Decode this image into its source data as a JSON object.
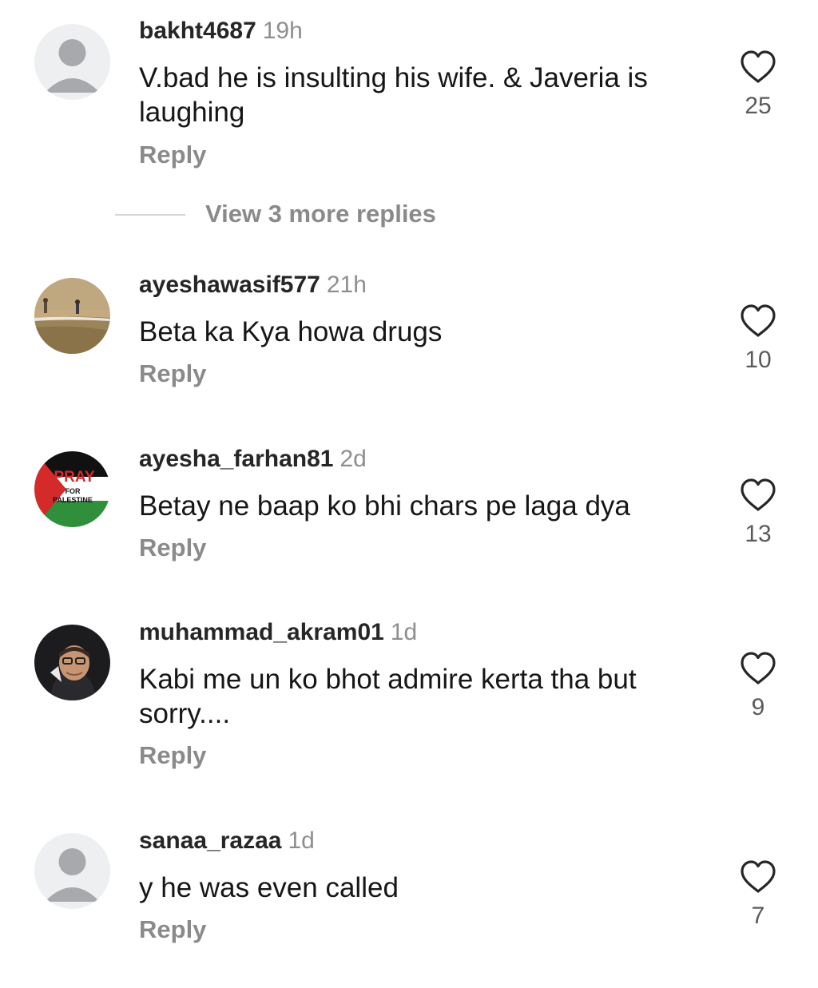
{
  "comments": [
    {
      "username": "bakht4687",
      "time": "19h",
      "text": "V.bad he is insulting his wife. & Javeria is laughing",
      "reply": "Reply",
      "likes": "25",
      "avatar": "default-avatar"
    },
    {
      "username": "ayeshawasif577",
      "time": "21h",
      "text": "Beta ka Kya howa drugs",
      "reply": "Reply",
      "likes": "10",
      "avatar": "landscape-photo-avatar"
    },
    {
      "username": "ayesha_farhan81",
      "time": "2d",
      "text": "Betay ne baap ko bhi chars pe laga dya",
      "reply": "Reply",
      "likes": "13",
      "avatar": "palestine-flag-avatar",
      "avatar_text": "PRAY FOR PALESTINE"
    },
    {
      "username": "muhammad_akram01",
      "time": "1d",
      "text": "Kabi me un ko bhot admire kerta tha but sorry....",
      "reply": "Reply",
      "likes": "9",
      "avatar": "portrait-photo-avatar"
    },
    {
      "username": "sanaa_razaa",
      "time": "1d",
      "text": "y he was even called",
      "reply": "Reply",
      "likes": "7",
      "avatar": "default-avatar"
    }
  ],
  "view_more_replies": "View 3 more replies",
  "colors": {
    "username": "#262626",
    "timestamp": "#8e8e8e",
    "reply": "#8a8a8a",
    "heart_outline": "#262626"
  },
  "icons": [
    "heart-icon"
  ]
}
